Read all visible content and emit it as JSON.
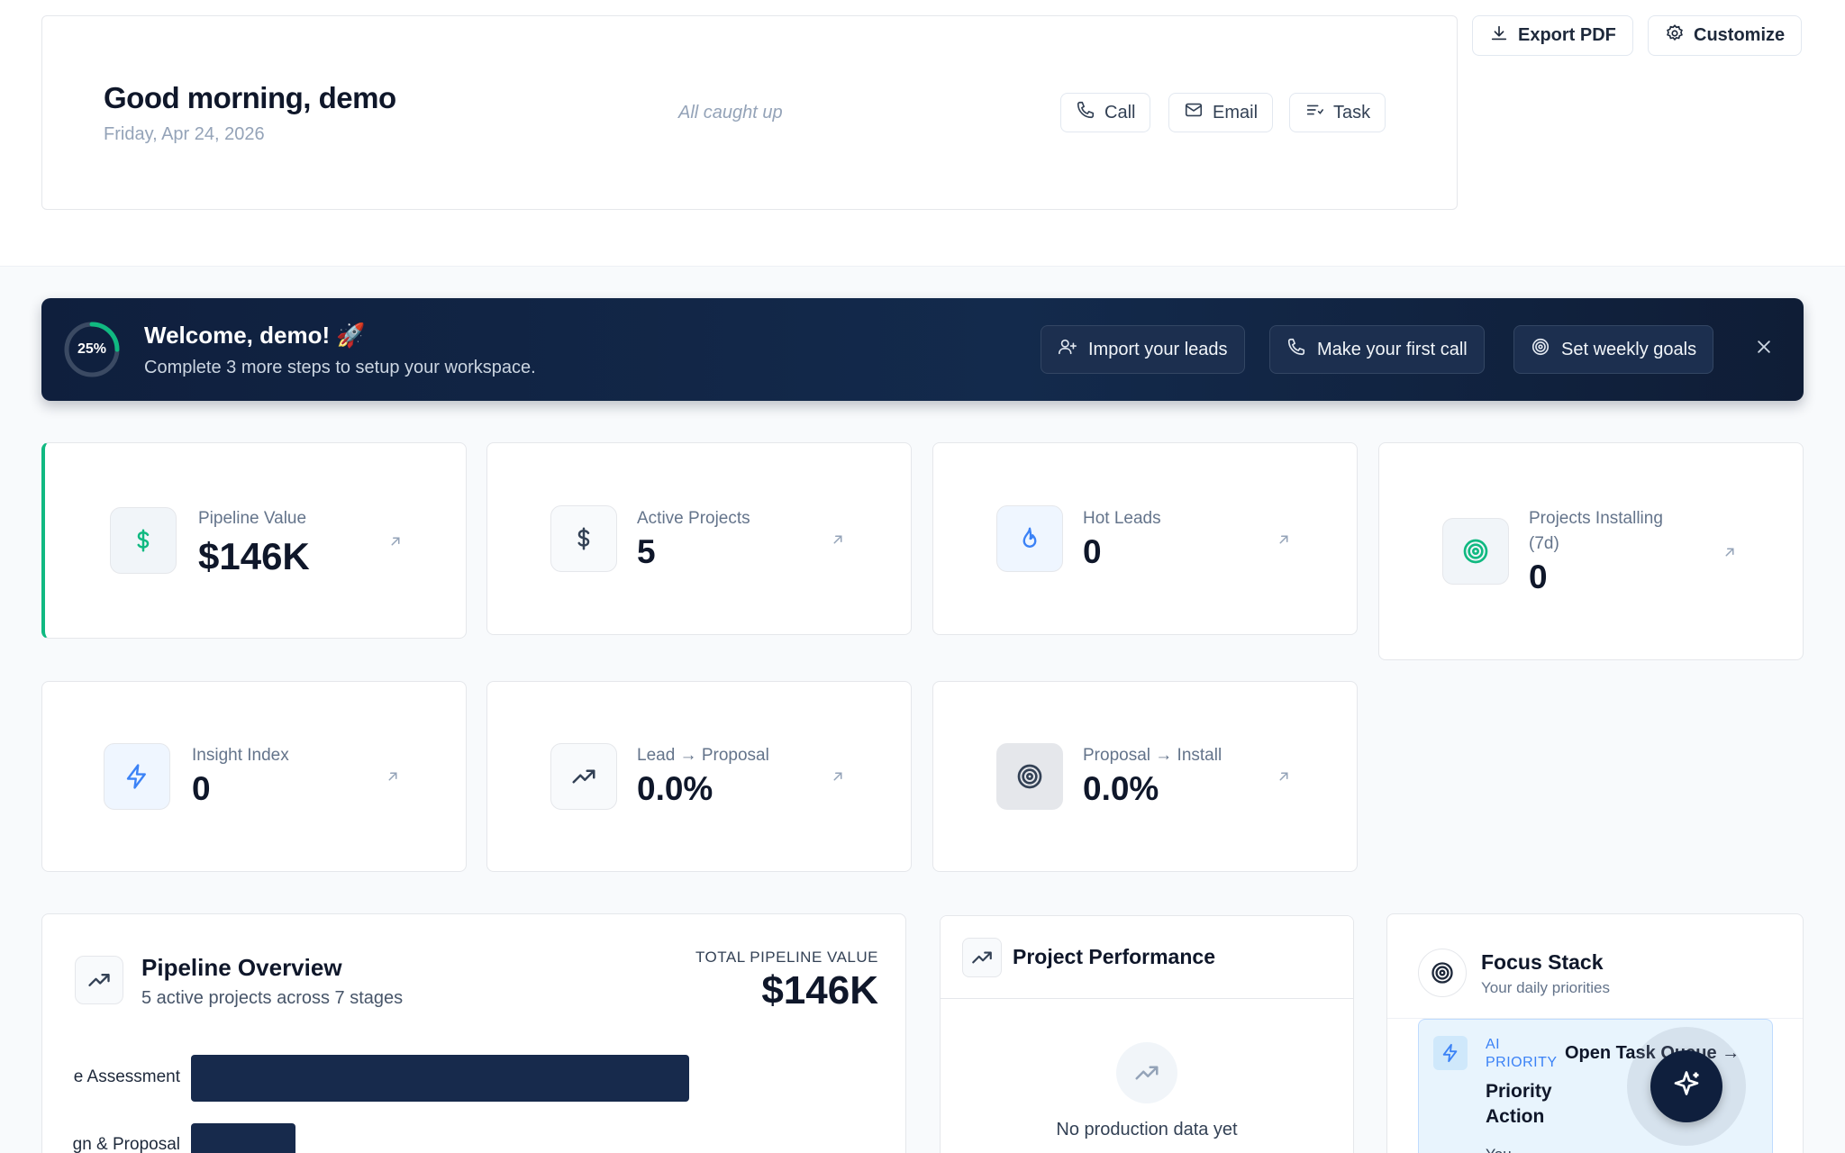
{
  "header": {
    "greeting": "Good morning, demo",
    "date": "Friday, Apr 24, 2026",
    "status": "All caught up",
    "quick_actions": [
      {
        "label": "Call",
        "icon": "phone-icon"
      },
      {
        "label": "Email",
        "icon": "mail-icon"
      },
      {
        "label": "Task",
        "icon": "task-icon"
      }
    ],
    "export_label": "Export PDF",
    "customize_label": "Customize"
  },
  "onboarding": {
    "progress_text": "25%",
    "progress_fraction": 0.25,
    "title": "Welcome, demo! 🚀",
    "subtitle": "Complete 3 more steps to setup your workspace.",
    "steps": [
      {
        "label": "Import your leads",
        "icon": "user-plus-icon"
      },
      {
        "label": "Make your first call",
        "icon": "phone-icon"
      },
      {
        "label": "Set weekly goals",
        "icon": "target-icon"
      }
    ],
    "accent_color": "#10b981"
  },
  "stats": [
    {
      "label": "Pipeline Value",
      "value": "$146K",
      "icon": "dollar-icon"
    },
    {
      "label": "Active Projects",
      "value": "5",
      "icon": "dollar-icon"
    },
    {
      "label": "Hot Leads",
      "value": "0",
      "icon": "flame-icon"
    },
    {
      "label": "Projects Installing",
      "label2": "(7d)",
      "value": "0",
      "icon": "target-icon"
    },
    {
      "label": "Insight Index",
      "value": "0",
      "icon": "bolt-icon"
    },
    {
      "label": "Lead → Proposal",
      "value": "0.0%",
      "icon": "trend-up-icon"
    },
    {
      "label": "Proposal → Install",
      "value": "0.0%",
      "icon": "target-icon"
    }
  ],
  "pipeline": {
    "title": "Pipeline Overview",
    "subtitle": "5 active projects across 7 stages",
    "total_label": "TOTAL PIPELINE VALUE",
    "total_value": "$146K",
    "stage_labels": [
      "e Assessment",
      "gn & Proposal"
    ],
    "stage_values_relative": [
      1.0,
      0.21
    ]
  },
  "performance": {
    "title": "Project Performance",
    "empty_title": "No production data yet"
  },
  "focus": {
    "title": "Focus Stack",
    "subtitle": "Your daily priorities",
    "badge_line1": "AI",
    "badge_line2": "PRIORITY",
    "open_queue": "Open Task Queue →",
    "item_title_1": "Priority",
    "item_title_2": "Action",
    "item_owner": "You"
  },
  "colors": {
    "navy": "#0f1f3d",
    "emerald": "#10b981",
    "blue": "#3b82f6"
  }
}
